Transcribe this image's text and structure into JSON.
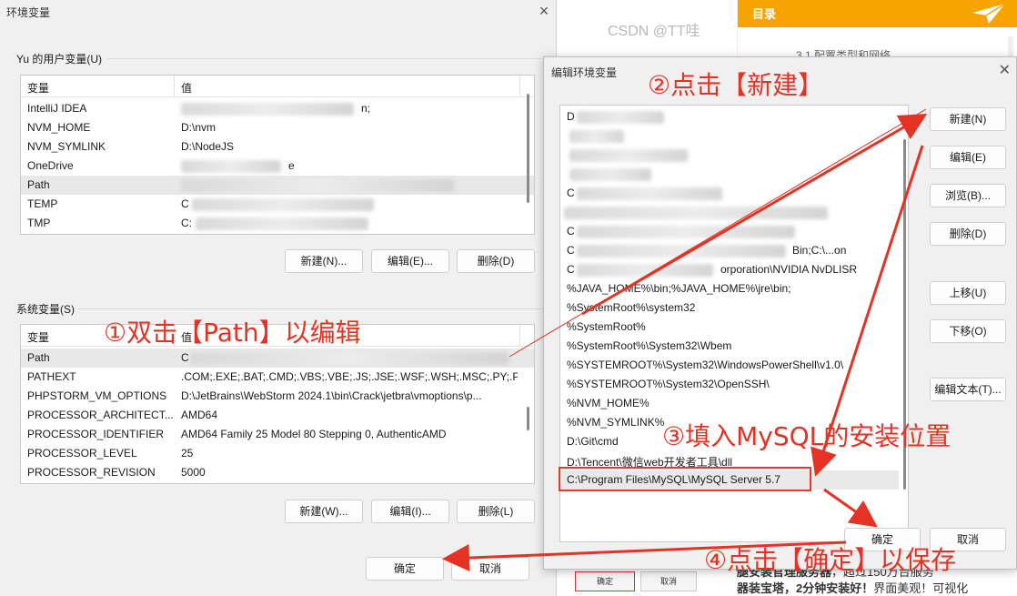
{
  "background": {
    "watermark": "CSDN @TT哇",
    "toc_title": "目录",
    "toc_item": "3.1 配置类型和网络",
    "footer_line1_bold": "腿安装官理服务器",
    "footer_line1_rest": "，超过150万台服务",
    "footer_line2_bold": "器装宝塔，2分钟安装好！",
    "footer_line2_rest": "界面美观！可视化",
    "mini_ok": "确定",
    "mini_cancel": "取消"
  },
  "env_window": {
    "title": "环境变量",
    "user_group_label": "Yu 的用户变量(U)",
    "system_group_label": "系统变量(S)",
    "col_variable": "变量",
    "col_value": "值",
    "user_vars": [
      {
        "name": "IntelliJ IDEA",
        "value": "n;"
      },
      {
        "name": "NVM_HOME",
        "value": "D:\\nvm"
      },
      {
        "name": "NVM_SYMLINK",
        "value": "D:\\NodeJS"
      },
      {
        "name": "OneDrive",
        "value": "e"
      },
      {
        "name": "Path",
        "value": ""
      },
      {
        "name": "TEMP",
        "value": "C"
      },
      {
        "name": "TMP",
        "value": "C:"
      }
    ],
    "system_vars": [
      {
        "name": "Path",
        "value": "C"
      },
      {
        "name": "PATHEXT",
        "value": ".COM;.EXE;.BAT;.CMD;.VBS;.VBE;.JS;.JSE;.WSF;.WSH;.MSC;.PY;.P..."
      },
      {
        "name": "PHPSTORM_VM_OPTIONS",
        "value": "D:\\JetBrains\\WebStorm 2024.1\\bin\\Crack\\jetbra\\vmoptions\\p..."
      },
      {
        "name": "PROCESSOR_ARCHITECT...",
        "value": "AMD64"
      },
      {
        "name": "PROCESSOR_IDENTIFIER",
        "value": "AMD64 Family 25 Model 80 Stepping 0, AuthenticAMD"
      },
      {
        "name": "PROCESSOR_LEVEL",
        "value": "25"
      },
      {
        "name": "PROCESSOR_REVISION",
        "value": "5000"
      }
    ],
    "user_buttons": {
      "new": "新建(N)...",
      "edit": "编辑(E)...",
      "delete": "删除(D)"
    },
    "system_buttons": {
      "new": "新建(W)...",
      "edit": "编辑(I)...",
      "delete": "删除(L)"
    },
    "ok": "确定",
    "cancel": "取消"
  },
  "edit_dialog": {
    "title": "编辑环境变量",
    "paths": [
      "D",
      "",
      "",
      "",
      "C",
      "",
      "C",
      "C",
      "C",
      "%JAVA_HOME%\\bin;%JAVA_HOME%\\jre\\bin;",
      "%SystemRoot%\\system32",
      "%SystemRoot%",
      "%SystemRoot%\\System32\\Wbem",
      "%SYSTEMROOT%\\System32\\WindowsPowerShell\\v1.0\\",
      "%SYSTEMROOT%\\System32\\OpenSSH\\",
      "%NVM_HOME%",
      "%NVM_SYMLINK%",
      "D:\\Git\\cmd",
      "D:\\Tencent\\微信web开发者工具\\dll",
      "C:\\Program Files\\MySQL\\MySQL Server 5.7"
    ],
    "path_partial_suffix_7": "Bin;C:\\...on",
    "path_partial_suffix_8": "orporation\\NVIDIA NvDLISR",
    "buttons": {
      "new": "新建(N)",
      "edit": "编辑(E)",
      "browse": "浏览(B)...",
      "delete": "删除(D)",
      "move_up": "上移(U)",
      "move_down": "下移(O)",
      "edit_text": "编辑文本(T)..."
    },
    "ok": "确定",
    "cancel": "取消"
  },
  "annotations": {
    "step1": "①双击【Path】以编辑",
    "step2": "②点击【新建】",
    "step3": "③填入MySQL的安装位置",
    "step4": "④点击【确定】以保存",
    "color": "#e53224"
  }
}
